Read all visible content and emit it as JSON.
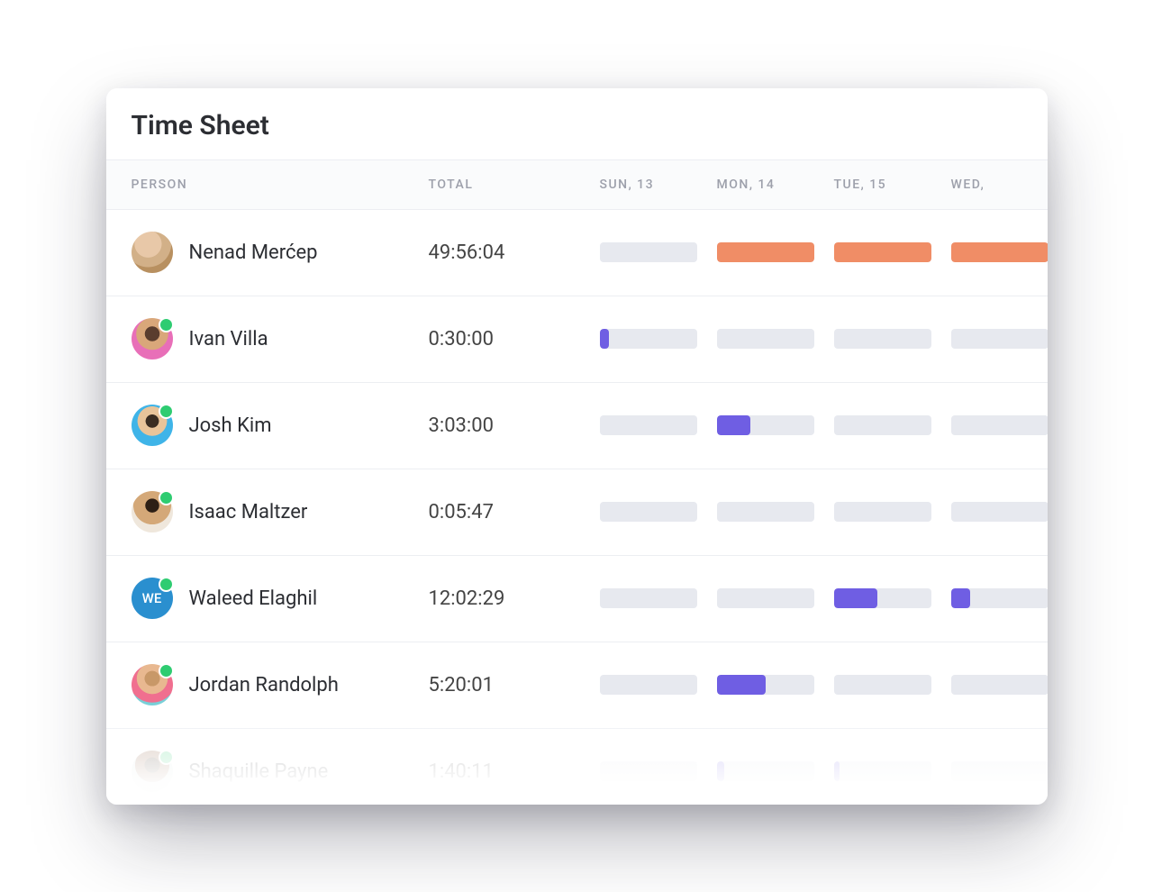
{
  "title": "Time Sheet",
  "columns": {
    "person": "PERSON",
    "total": "TOTAL",
    "days": [
      "SUN, 13",
      "MON, 14",
      "TUE, 15",
      "WED,"
    ]
  },
  "colors": {
    "orange": "#f08d66",
    "purple": "#6f5ee3",
    "bar_bg": "#e7e9ef"
  },
  "rows": [
    {
      "name": "Nenad Merćep",
      "total": "49:56:04",
      "avatar": {
        "type": "photo",
        "class": "av0",
        "initials": ""
      },
      "presence": false,
      "bars": [
        {
          "fill": 0,
          "color": "orange"
        },
        {
          "fill": 100,
          "color": "orange"
        },
        {
          "fill": 100,
          "color": "orange"
        },
        {
          "fill": 100,
          "color": "orange"
        }
      ],
      "faded": false
    },
    {
      "name": "Ivan Villa",
      "total": "0:30:00",
      "avatar": {
        "type": "photo",
        "class": "av1",
        "initials": ""
      },
      "presence": true,
      "bars": [
        {
          "fill": 10,
          "color": "purple"
        },
        {
          "fill": 0,
          "color": "purple"
        },
        {
          "fill": 0,
          "color": "purple"
        },
        {
          "fill": 0,
          "color": "purple"
        }
      ],
      "faded": false
    },
    {
      "name": "Josh Kim",
      "total": "3:03:00",
      "avatar": {
        "type": "photo",
        "class": "av2",
        "initials": ""
      },
      "presence": true,
      "bars": [
        {
          "fill": 0,
          "color": "purple"
        },
        {
          "fill": 35,
          "color": "purple"
        },
        {
          "fill": 0,
          "color": "purple"
        },
        {
          "fill": 0,
          "color": "purple"
        }
      ],
      "faded": false
    },
    {
      "name": "Isaac Maltzer",
      "total": "0:05:47",
      "avatar": {
        "type": "photo",
        "class": "av3",
        "initials": ""
      },
      "presence": true,
      "bars": [
        {
          "fill": 0,
          "color": "purple"
        },
        {
          "fill": 0,
          "color": "purple"
        },
        {
          "fill": 0,
          "color": "purple"
        },
        {
          "fill": 0,
          "color": "purple"
        }
      ],
      "faded": false
    },
    {
      "name": "Waleed Elaghil",
      "total": "12:02:29",
      "avatar": {
        "type": "initials",
        "class": "av4",
        "initials": "WE"
      },
      "presence": true,
      "bars": [
        {
          "fill": 0,
          "color": "purple"
        },
        {
          "fill": 0,
          "color": "purple"
        },
        {
          "fill": 45,
          "color": "purple"
        },
        {
          "fill": 20,
          "color": "purple"
        }
      ],
      "faded": false
    },
    {
      "name": "Jordan Randolph",
      "total": "5:20:01",
      "avatar": {
        "type": "photo",
        "class": "av5",
        "initials": ""
      },
      "presence": true,
      "bars": [
        {
          "fill": 0,
          "color": "purple"
        },
        {
          "fill": 50,
          "color": "purple"
        },
        {
          "fill": 0,
          "color": "purple"
        },
        {
          "fill": 0,
          "color": "purple"
        }
      ],
      "faded": false
    },
    {
      "name": "Shaquille Payne",
      "total": "1:40:11",
      "avatar": {
        "type": "photo",
        "class": "av6",
        "initials": ""
      },
      "presence": true,
      "bars": [
        {
          "fill": 0,
          "color": "purple"
        },
        {
          "fill": 8,
          "color": "purple"
        },
        {
          "fill": 6,
          "color": "purple"
        },
        {
          "fill": 0,
          "color": "purple"
        }
      ],
      "faded": true
    }
  ]
}
